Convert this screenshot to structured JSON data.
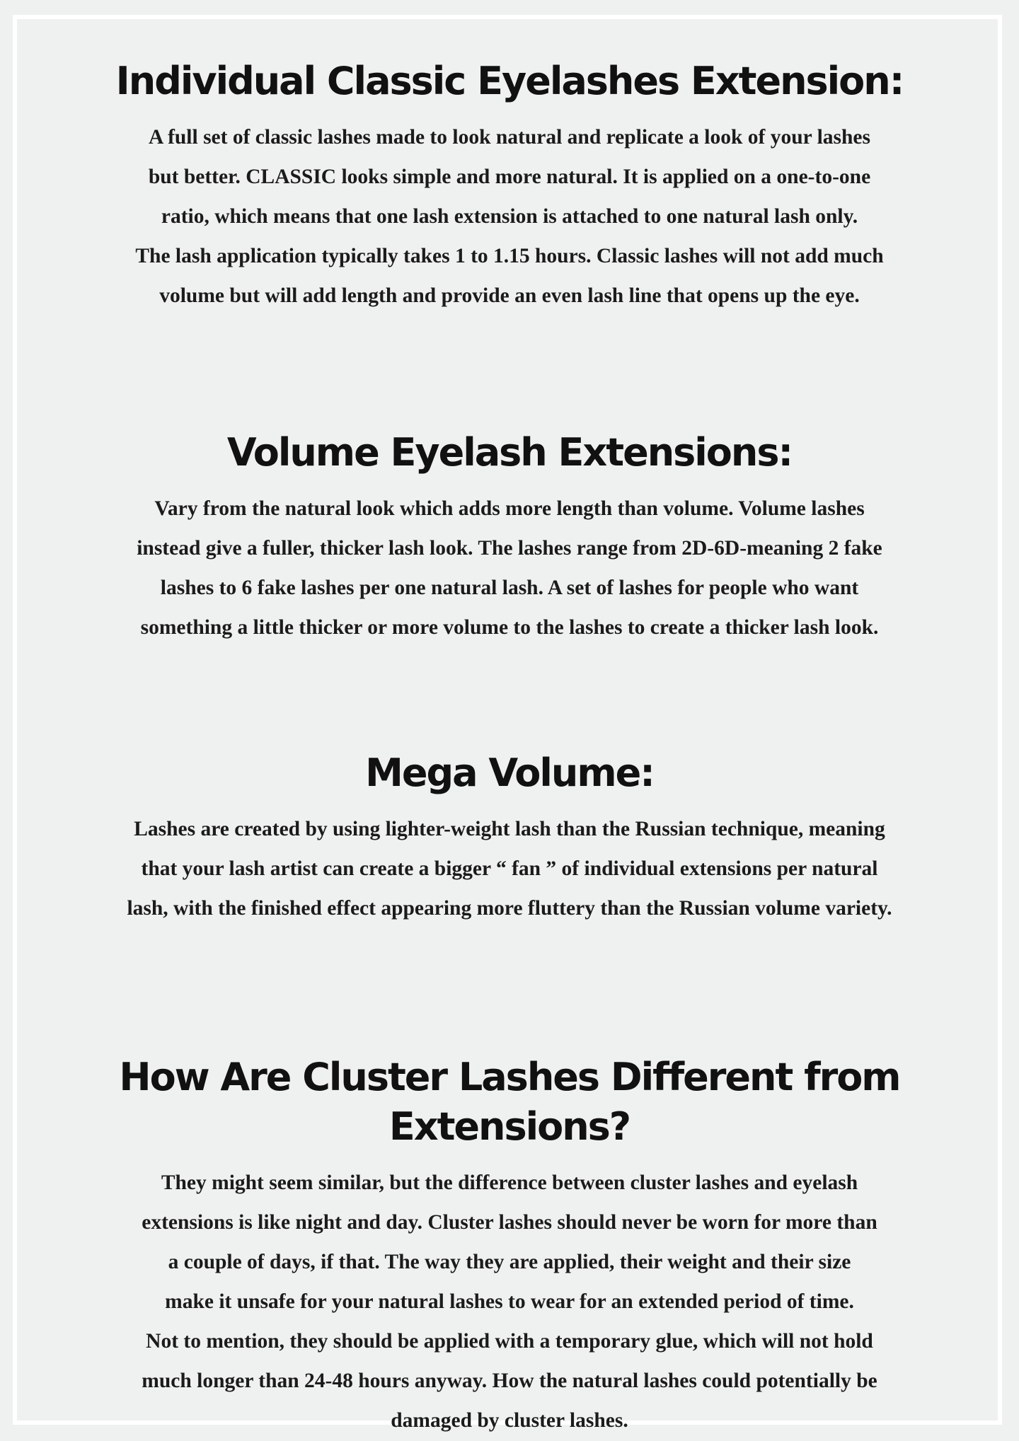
{
  "sections": [
    {
      "title": "Individual Classic Eyelashes Extension:",
      "lines": [
        "A full set of classic lashes made to look natural and replicate a look of your lashes",
        "but better. CLASSIC looks simple and more natural. It is applied on a one-to-one",
        "ratio, which means that one lash extension is attached to one natural lash only.",
        "The lash application typically takes 1 to 1.15 hours. Classic lashes will not add much",
        "volume but will add length and provide an even lash line that opens up the eye."
      ]
    },
    {
      "title": "Volume Eyelash Extensions:",
      "lines": [
        "Vary from the natural look which adds more length than volume. Volume lashes",
        "instead give a fuller, thicker lash look. The lashes range from 2D-6D-meaning 2 fake",
        "lashes to 6 fake lashes per one natural lash. A set of lashes for people who want",
        "something a little thicker or more volume to the lashes to create a thicker lash look."
      ]
    },
    {
      "title": "Mega Volume:",
      "lines": [
        "Lashes are created by using lighter-weight lash than the Russian technique, meaning",
        "that your lash artist can create a bigger “ fan ” of individual extensions per natural",
        "lash, with the finished effect appearing more fluttery than the Russian volume variety."
      ]
    },
    {
      "title": "How Are Cluster Lashes Different from Extensions?",
      "lines": [
        "They might seem similar, but the difference between cluster lashes and eyelash",
        "extensions is like night and day. Cluster lashes should never be worn for more than",
        "a couple of days, if that. The way they are applied, their weight and their size",
        "make it unsafe for your natural lashes to wear for an extended period of time.",
        "Not to mention, they should be applied with a temporary glue, which will not hold",
        "much longer than 24-48 hours anyway. How the natural lashes could potentially be",
        "damaged by cluster lashes."
      ]
    }
  ]
}
